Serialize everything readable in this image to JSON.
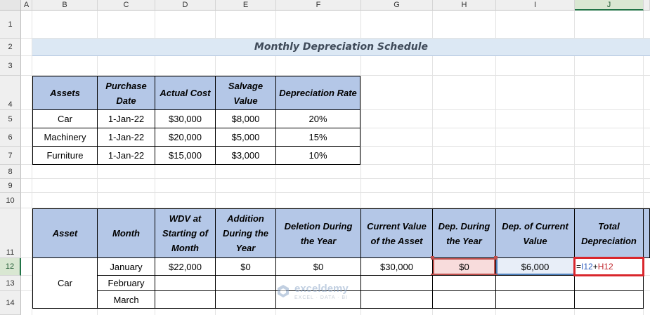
{
  "sheet": {
    "columns": [
      "A",
      "B",
      "C",
      "D",
      "E",
      "F",
      "G",
      "H",
      "I",
      "J"
    ],
    "rows": [
      "1",
      "2",
      "3",
      "4",
      "5",
      "6",
      "7",
      "8",
      "9",
      "10",
      "11",
      "12",
      "13",
      "14"
    ],
    "selected_column": "J",
    "selected_row": "12"
  },
  "title": "Monthly Depreciation Schedule",
  "assets_table": {
    "headers": [
      "Assets",
      "Purchase Date",
      "Actual Cost",
      "Salvage Value",
      "Depreciation Rate"
    ],
    "rows": [
      [
        "Car",
        "1-Jan-22",
        "$30,000",
        "$8,000",
        "20%"
      ],
      [
        "Machinery",
        "1-Jan-22",
        "$20,000",
        "$5,000",
        "15%"
      ],
      [
        "Furniture",
        "1-Jan-22",
        "$15,000",
        "$3,000",
        "10%"
      ]
    ]
  },
  "schedule_table": {
    "headers": [
      "Asset",
      "Month",
      "WDV at Starting of Month",
      "Addition During the Year",
      "Deletion During the Year",
      "Current Value of the Asset",
      "Dep. During the Year",
      "Dep. of Current Value",
      "Total Depreciation"
    ],
    "asset": "Car",
    "months": [
      "January",
      "February",
      "March"
    ],
    "row1": [
      "$22,000",
      "$0",
      "$0",
      "$30,000",
      "$0",
      "$6,000"
    ],
    "formula": {
      "eq": "=",
      "ref1": "I12",
      "op": "+",
      "ref2": "H12"
    }
  },
  "watermark": {
    "name": "exceldemy",
    "tagline": "EXCEL · DATA · BI"
  },
  "colors": {
    "header_fill": "#b4c7e7",
    "title_band": "#dce8f4",
    "selection": "#217346",
    "formula_border": "#d9262c",
    "ref1": "#2f5fbf",
    "ref2": "#c0262c"
  }
}
